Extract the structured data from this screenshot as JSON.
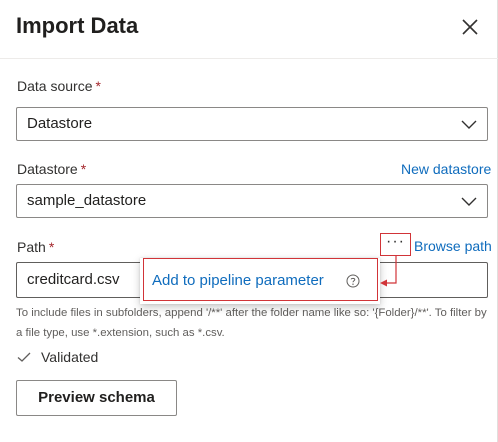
{
  "dialog": {
    "title": "Import Data",
    "close_icon": "close-icon"
  },
  "fields": {
    "data_source": {
      "label": "Data source",
      "required_mark": "*",
      "value": "Datastore"
    },
    "datastore": {
      "label": "Datastore",
      "required_mark": "*",
      "value": "sample_datastore",
      "link": "New datastore"
    },
    "path": {
      "label": "Path",
      "required_mark": "*",
      "value": "creditcard.csv",
      "link": "Browse path",
      "more_button": "···",
      "help": "To include files in subfolders, append '/**' after the folder name like so: '{Folder}/**'. To filter by a file type, use *.extension, such as *.csv."
    }
  },
  "context_menu": {
    "item": "Add to pipeline parameter",
    "help_icon": "help-circle-icon"
  },
  "status": {
    "text": "Validated",
    "icon": "checkmark-icon"
  },
  "actions": {
    "preview": "Preview schema"
  },
  "colors": {
    "link": "#0f6cbd",
    "annotation": "#d13438",
    "required": "#a4262c"
  }
}
